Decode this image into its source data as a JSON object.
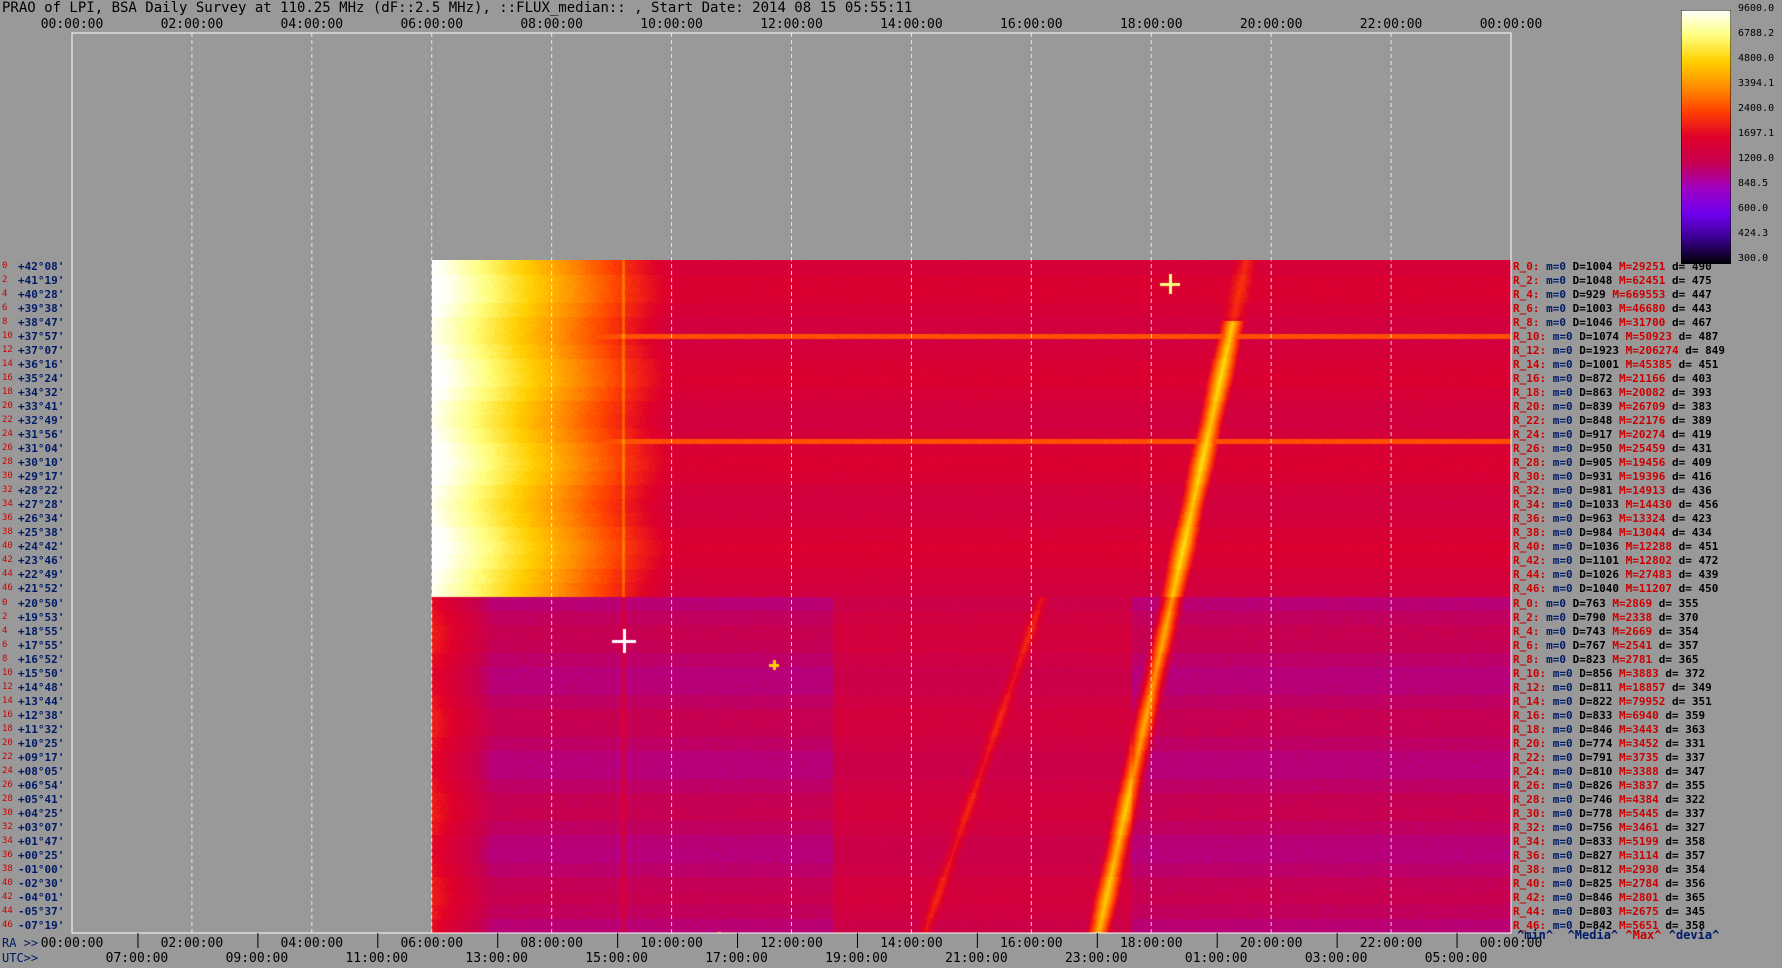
{
  "title": "PRAO of LPI, BSA Daily Survey at 110.25 MHz (dF::2.5 MHz), ::FLUX_median:: , Start Date: 2014 08 15 05:55:11",
  "top_ticks": [
    "00:00:00",
    "02:00:00",
    "04:00:00",
    "06:00:00",
    "08:00:00",
    "10:00:00",
    "12:00:00",
    "14:00:00",
    "16:00:00",
    "18:00:00",
    "20:00:00",
    "22:00:00",
    "00:00:00"
  ],
  "bottom": {
    "ra_label": "RA >>",
    "ra_ticks": [
      "00:00:00",
      "02:00:00",
      "04:00:00",
      "06:00:00",
      "08:00:00",
      "10:00:00",
      "12:00:00",
      "14:00:00",
      "16:00:00",
      "18:00:00",
      "20:00:00",
      "22:00:00",
      "00:00:00"
    ],
    "utc_label": "UTC>>",
    "utc_ticks": [
      "07:00:00",
      "09:00:00",
      "11:00:00",
      "13:00:00",
      "15:00:00",
      "17:00:00",
      "19:00:00",
      "21:00:00",
      "23:00:00",
      "01:00:00",
      "03:00:00",
      "05:00:00"
    ]
  },
  "colorbar": {
    "labels": [
      "9600.0",
      "6788.2",
      "4800.0",
      "3394.1",
      "2400.0",
      "1697.1",
      "1200.0",
      "848.5",
      "600.0",
      "424.3",
      "300.0"
    ],
    "colors": [
      "#ffffff",
      "#ffff80",
      "#ffd000",
      "#ff9000",
      "#ff4000",
      "#e0002a",
      "#c8004e",
      "#a000c0",
      "#7000f0",
      "#3a0090",
      "#000000"
    ]
  },
  "legend": {
    "a": "^min^  ^Media^ ",
    "b": "^Max^",
    "c": " ^devia^"
  },
  "chart_data": {
    "type": "heatmap",
    "title": "PRAO of LPI, BSA Daily Survey at 110.25 MHz (dF::2.5 MHz), ::FLUX_median:: , Start Date: 2014 08 15 05:55:11",
    "x_axis": "RA / UTC",
    "color_scale": {
      "min": 300.0,
      "max": 9600.0,
      "log": true
    },
    "declinations": [
      "+42°08'",
      "+41°19'",
      "+40°28'",
      "+39°38'",
      "+38°47'",
      "+37°57'",
      "+37°07'",
      "+36°16'",
      "+35°24'",
      "+34°32'",
      "+33°41'",
      "+32°49'",
      "+31°56'",
      "+31°04'",
      "+30°10'",
      "+29°17'",
      "+28°22'",
      "+27°28'",
      "+26°34'",
      "+25°38'",
      "+24°42'",
      "+23°46'",
      "+22°49'",
      "+21°52'",
      "+20°50'",
      "+19°53'",
      "+18°55'",
      "+17°55'",
      "+16°52'",
      "+15°50'",
      "+14°48'",
      "+13°44'",
      "+12°38'",
      "+11°32'",
      "+10°25'",
      "+09°17'",
      "+08°05'",
      "+06°54'",
      "+05°41'",
      "+04°25'",
      "+03°07'",
      "+01°47'",
      "+00°25'",
      "-01°00'",
      "-02°30'",
      "-04°01'",
      "-05°37'",
      "-07°19'"
    ],
    "row_index_labels": [
      "0",
      "2",
      "4",
      "6",
      "8",
      "10",
      "12",
      "14",
      "16",
      "18",
      "20",
      "22",
      "24",
      "26",
      "28",
      "30",
      "32",
      "34",
      "36",
      "38",
      "40",
      "42",
      "44",
      "46",
      "0",
      "2",
      "4",
      "6",
      "8",
      "10",
      "12",
      "14",
      "16",
      "18",
      "20",
      "22",
      "24",
      "26",
      "28",
      "30",
      "32",
      "34",
      "36",
      "38",
      "40",
      "42",
      "44",
      "46"
    ],
    "row_stats": [
      {
        "r": "R_0:",
        "min": "m=0",
        "med": "D=1004",
        "max": "M=29251",
        "dev": "d= 490"
      },
      {
        "r": "R_2:",
        "min": "m=0",
        "med": "D=1048",
        "max": "M=62451",
        "dev": "d= 475"
      },
      {
        "r": "R_4:",
        "min": "m=0",
        "med": "D=929",
        "max": "M=669553",
        "dev": "d= 447"
      },
      {
        "r": "R_6:",
        "min": "m=0",
        "med": "D=1003",
        "max": "M=46680",
        "dev": "d= 443"
      },
      {
        "r": "R_8:",
        "min": "m=0",
        "med": "D=1046",
        "max": "M=31700",
        "dev": "d= 467"
      },
      {
        "r": "R_10:",
        "min": "m=0",
        "med": "D=1074",
        "max": "M=50923",
        "dev": "d= 487"
      },
      {
        "r": "R_12:",
        "min": "m=0",
        "med": "D=1923",
        "max": "M=206274",
        "dev": "d= 849"
      },
      {
        "r": "R_14:",
        "min": "m=0",
        "med": "D=1001",
        "max": "M=45385",
        "dev": "d= 451"
      },
      {
        "r": "R_16:",
        "min": "m=0",
        "med": "D=872",
        "max": "M=21166",
        "dev": "d= 403"
      },
      {
        "r": "R_18:",
        "min": "m=0",
        "med": "D=863",
        "max": "M=20082",
        "dev": "d= 393"
      },
      {
        "r": "R_20:",
        "min": "m=0",
        "med": "D=839",
        "max": "M=26709",
        "dev": "d= 383"
      },
      {
        "r": "R_22:",
        "min": "m=0",
        "med": "D=848",
        "max": "M=22176",
        "dev": "d= 389"
      },
      {
        "r": "R_24:",
        "min": "m=0",
        "med": "D=917",
        "max": "M=20274",
        "dev": "d= 419"
      },
      {
        "r": "R_26:",
        "min": "m=0",
        "med": "D=950",
        "max": "M=25459",
        "dev": "d= 431"
      },
      {
        "r": "R_28:",
        "min": "m=0",
        "med": "D=905",
        "max": "M=19456",
        "dev": "d= 409"
      },
      {
        "r": "R_30:",
        "min": "m=0",
        "med": "D=931",
        "max": "M=19396",
        "dev": "d= 416"
      },
      {
        "r": "R_32:",
        "min": "m=0",
        "med": "D=981",
        "max": "M=14913",
        "dev": "d= 436"
      },
      {
        "r": "R_34:",
        "min": "m=0",
        "med": "D=1033",
        "max": "M=14430",
        "dev": "d= 456"
      },
      {
        "r": "R_36:",
        "min": "m=0",
        "med": "D=963",
        "max": "M=13324",
        "dev": "d= 423"
      },
      {
        "r": "R_38:",
        "min": "m=0",
        "med": "D=984",
        "max": "M=13044",
        "dev": "d= 434"
      },
      {
        "r": "R_40:",
        "min": "m=0",
        "med": "D=1036",
        "max": "M=12288",
        "dev": "d= 451"
      },
      {
        "r": "R_42:",
        "min": "m=0",
        "med": "D=1101",
        "max": "M=12802",
        "dev": "d= 472"
      },
      {
        "r": "R_44:",
        "min": "m=0",
        "med": "D=1026",
        "max": "M=27483",
        "dev": "d= 439"
      },
      {
        "r": "R_46:",
        "min": "m=0",
        "med": "D=1040",
        "max": "M=11207",
        "dev": "d= 450"
      },
      {
        "r": "R_0:",
        "min": "m=0",
        "med": "D=763",
        "max": "M=2869",
        "dev": "d= 355"
      },
      {
        "r": "R_2:",
        "min": "m=0",
        "med": "D=790",
        "max": "M=2338",
        "dev": "d= 370"
      },
      {
        "r": "R_4:",
        "min": "m=0",
        "med": "D=743",
        "max": "M=2669",
        "dev": "d= 354"
      },
      {
        "r": "R_6:",
        "min": "m=0",
        "med": "D=767",
        "max": "M=2541",
        "dev": "d= 357"
      },
      {
        "r": "R_8:",
        "min": "m=0",
        "med": "D=823",
        "max": "M=2781",
        "dev": "d= 365"
      },
      {
        "r": "R_10:",
        "min": "m=0",
        "med": "D=856",
        "max": "M=3883",
        "dev": "d= 372"
      },
      {
        "r": "R_12:",
        "min": "m=0",
        "med": "D=811",
        "max": "M=18857",
        "dev": "d= 349"
      },
      {
        "r": "R_14:",
        "min": "m=0",
        "med": "D=822",
        "max": "M=79952",
        "dev": "d= 351"
      },
      {
        "r": "R_16:",
        "min": "m=0",
        "med": "D=833",
        "max": "M=6940",
        "dev": "d= 359"
      },
      {
        "r": "R_18:",
        "min": "m=0",
        "med": "D=846",
        "max": "M=3443",
        "dev": "d= 363"
      },
      {
        "r": "R_20:",
        "min": "m=0",
        "med": "D=774",
        "max": "M=3452",
        "dev": "d= 331"
      },
      {
        "r": "R_22:",
        "min": "m=0",
        "med": "D=791",
        "max": "M=3735",
        "dev": "d= 337"
      },
      {
        "r": "R_24:",
        "min": "m=0",
        "med": "D=810",
        "max": "M=3388",
        "dev": "d= 347"
      },
      {
        "r": "R_26:",
        "min": "m=0",
        "med": "D=826",
        "max": "M=3837",
        "dev": "d= 355"
      },
      {
        "r": "R_28:",
        "min": "m=0",
        "med": "D=746",
        "max": "M=4384",
        "dev": "d= 322"
      },
      {
        "r": "R_30:",
        "min": "m=0",
        "med": "D=778",
        "max": "M=5445",
        "dev": "d= 337"
      },
      {
        "r": "R_32:",
        "min": "m=0",
        "med": "D=756",
        "max": "M=3461",
        "dev": "d= 327"
      },
      {
        "r": "R_34:",
        "min": "m=0",
        "med": "D=833",
        "max": "M=5199",
        "dev": "d= 358"
      },
      {
        "r": "R_36:",
        "min": "m=0",
        "med": "D=827",
        "max": "M=3114",
        "dev": "d= 357"
      },
      {
        "r": "R_38:",
        "min": "m=0",
        "med": "D=812",
        "max": "M=2930",
        "dev": "d= 354"
      },
      {
        "r": "R_40:",
        "min": "m=0",
        "med": "D=825",
        "max": "M=2784",
        "dev": "d= 356"
      },
      {
        "r": "R_42:",
        "min": "m=0",
        "med": "D=846",
        "max": "M=2801",
        "dev": "d= 365"
      },
      {
        "r": "R_44:",
        "min": "m=0",
        "med": "D=803",
        "max": "M=2675",
        "dev": "d= 345"
      },
      {
        "r": "R_46:",
        "min": "m=0",
        "med": "D=842",
        "max": "M=5651",
        "dev": "d= 358"
      }
    ]
  }
}
